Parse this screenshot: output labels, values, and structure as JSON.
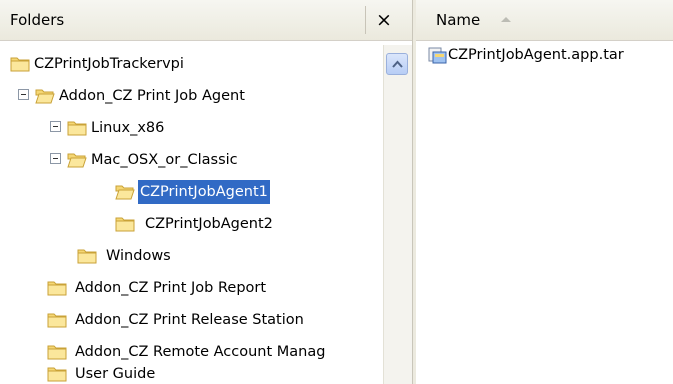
{
  "folders_pane": {
    "title": "Folders",
    "close_symbol": "×"
  },
  "tree": [
    {
      "label": "CZPrintJobTrackervpi",
      "expander": false,
      "icon": "folder-icon",
      "selected": false
    },
    {
      "label": "Addon_CZ Print Job Agent",
      "expander": true,
      "icon": "folder-open-icon",
      "selected": false
    },
    {
      "label": "Linux_x86",
      "expander": true,
      "icon": "folder-icon",
      "selected": false
    },
    {
      "label": "Mac_OSX_or_Classic",
      "expander": true,
      "icon": "folder-open-icon",
      "selected": false
    },
    {
      "label": "CZPrintJobAgent1",
      "expander": false,
      "icon": "folder-open-icon",
      "selected": true
    },
    {
      "label": "CZPrintJobAgent2",
      "expander": false,
      "icon": "folder-icon",
      "selected": false
    },
    {
      "label": "Windows",
      "expander": false,
      "icon": "folder-icon",
      "selected": false
    },
    {
      "label": "Addon_CZ Print Job Report",
      "expander": false,
      "icon": "folder-icon",
      "selected": false
    },
    {
      "label": "Addon_CZ Print Release Station",
      "expander": false,
      "icon": "folder-icon",
      "selected": false
    },
    {
      "label": "Addon_CZ Remote Account Manag",
      "expander": false,
      "icon": "folder-icon",
      "selected": false
    },
    {
      "label": "User Guide",
      "expander": false,
      "icon": "folder-icon",
      "selected": false
    }
  ],
  "file_pane": {
    "column_name": "Name",
    "sort": "ascending",
    "files": [
      {
        "name": "CZPrintJobAgent.app.tar",
        "icon": "archive-file-icon"
      }
    ]
  },
  "colors": {
    "selection": "#316ac5",
    "folder": "#f5d774",
    "header": "#ebe9dd"
  }
}
